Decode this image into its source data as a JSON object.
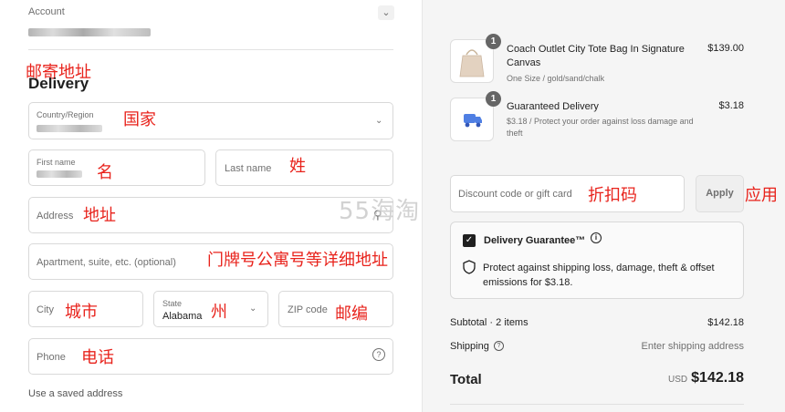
{
  "account": {
    "label": "Account",
    "chevron": "chevron-down-icon"
  },
  "delivery": {
    "heading": "Delivery"
  },
  "fields": {
    "country_label": "Country/Region",
    "first_name_label": "First name",
    "last_name_placeholder": "Last name",
    "address_placeholder": "Address",
    "apartment_placeholder": "Apartment, suite, etc. (optional)",
    "city_placeholder": "City",
    "state_label": "State",
    "state_value": "Alabama",
    "zip_placeholder": "ZIP code",
    "phone_placeholder": "Phone"
  },
  "saved_address_link": "Use a saved address",
  "annotations": {
    "mailing_address": "邮寄地址",
    "country": "国家",
    "first_name": "名",
    "last_name": "姓",
    "address": "地址",
    "apartment": "门牌号公寓号等详细地址",
    "city": "城市",
    "state": "州",
    "zip": "邮编",
    "phone": "电话",
    "discount": "折扣码",
    "apply": "应用"
  },
  "watermark": "55海淘",
  "order": {
    "items": [
      {
        "qty": "1",
        "name": "Coach Outlet City Tote Bag In Signature Canvas",
        "variant": "One Size / gold/sand/chalk",
        "price": "$139.00"
      },
      {
        "qty": "1",
        "name": "Guaranteed Delivery",
        "variant": "$3.18 / Protect your order against loss damage and theft",
        "price": "$3.18"
      }
    ],
    "discount_placeholder": "Discount code or gift card",
    "apply_label": "Apply",
    "guarantee": {
      "title": "Delivery Guarantee™",
      "description": "Protect against shipping loss, damage, theft & offset emissions for $3.18.",
      "checked": true
    },
    "subtotal_label": "Subtotal · 2 items",
    "subtotal_value": "$142.18",
    "shipping_label": "Shipping",
    "shipping_value": "Enter shipping address",
    "total_label": "Total",
    "total_currency": "USD",
    "total_value": "$142.18"
  }
}
